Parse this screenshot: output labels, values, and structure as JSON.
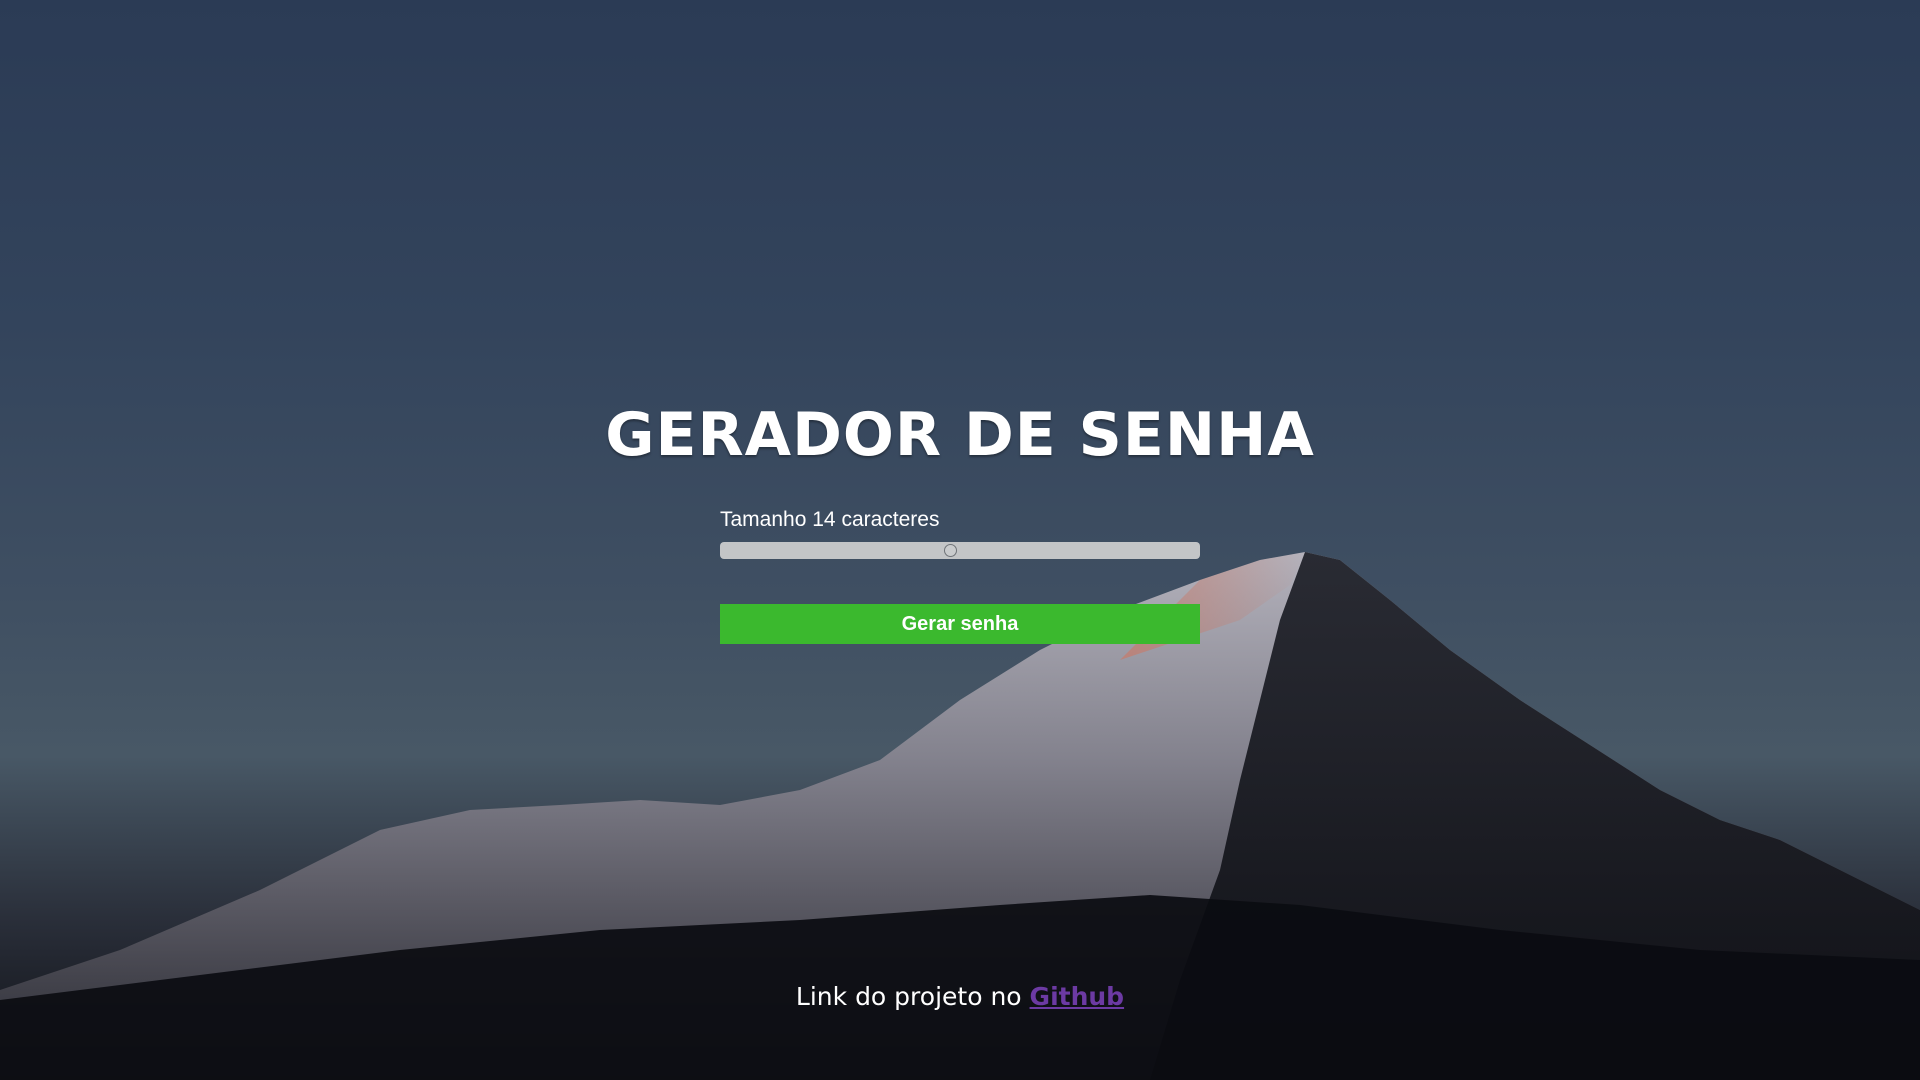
{
  "page": {
    "title": "GERADOR DE SENHA"
  },
  "generator": {
    "size_prefix": "Tamanho",
    "size_value": "14",
    "size_suffix": "caracteres",
    "slider_fraction": 0.48,
    "button_label": "Gerar senha"
  },
  "footer": {
    "text": "Link do projeto no",
    "link_label": "Github"
  },
  "colors": {
    "button": "#3bb92e",
    "link": "#6c3aa3",
    "title": "#ffffff"
  }
}
